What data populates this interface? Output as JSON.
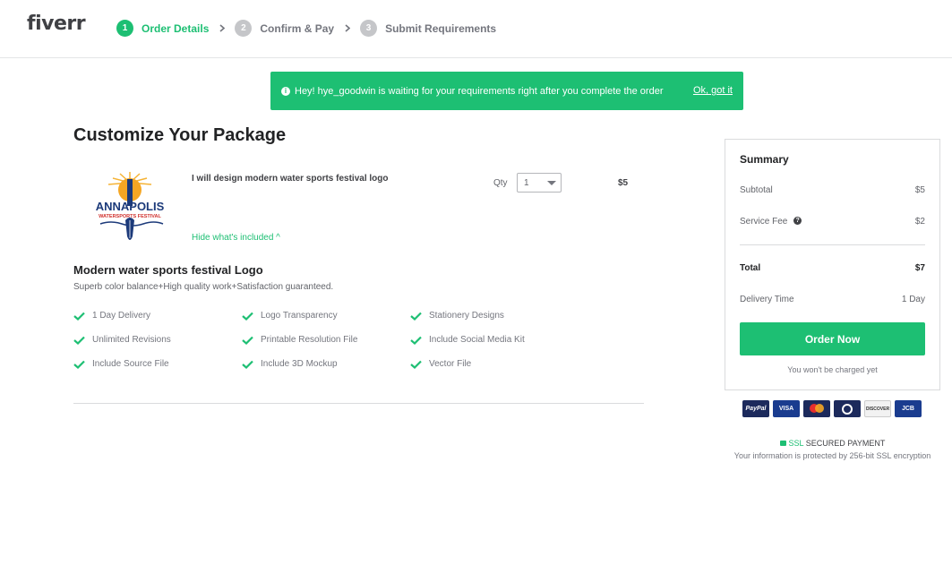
{
  "header": {
    "logo": "fiverr",
    "steps": [
      {
        "num": "1",
        "label": "Order Details"
      },
      {
        "num": "2",
        "label": "Confirm & Pay"
      },
      {
        "num": "3",
        "label": "Submit Requirements"
      }
    ]
  },
  "notice": {
    "text": "Hey! hye_goodwin is waiting for your requirements right after you complete the order",
    "link": "Ok, got it"
  },
  "main": {
    "title": "Customize Your Package",
    "gig": {
      "title": "I will design modern water sports festival logo",
      "qty_label": "Qty",
      "qty_value": "1",
      "price": "$5",
      "hide_link": "Hide what's included ^",
      "logo_text_main": "ANNAPOLIS",
      "logo_text_sub": "WATERSPORTS FESTIVAL"
    },
    "package": {
      "title": "Modern water sports festival Logo",
      "description": "Superb color balance+High quality work+Satisfaction guaranteed.",
      "features": [
        "1 Day Delivery",
        "Logo Transparency",
        "Stationery Designs",
        "Unlimited Revisions",
        "Printable Resolution File",
        "Include Social Media Kit",
        "Include Source File",
        "Include 3D Mockup",
        "Vector File"
      ]
    }
  },
  "summary": {
    "title": "Summary",
    "subtotal_label": "Subtotal",
    "subtotal_value": "$5",
    "fee_label": "Service Fee",
    "fee_value": "$2",
    "total_label": "Total",
    "total_value": "$7",
    "delivery_label": "Delivery Time",
    "delivery_value": "1 Day",
    "order_button": "Order Now",
    "charged_note": "You won't be charged yet"
  },
  "payment": {
    "cards": [
      "PayPal",
      "VISA",
      "mastercard",
      "diners",
      "DISCOVER",
      "JCB"
    ],
    "ssl_label": "SSL",
    "ssl_text": "SECURED PAYMENT",
    "ssl_sub": "Your information is protected by 256-bit SSL encryption"
  },
  "colors": {
    "brand_green": "#1dbf73",
    "text_dark": "#222325",
    "text_gray": "#74767e"
  }
}
